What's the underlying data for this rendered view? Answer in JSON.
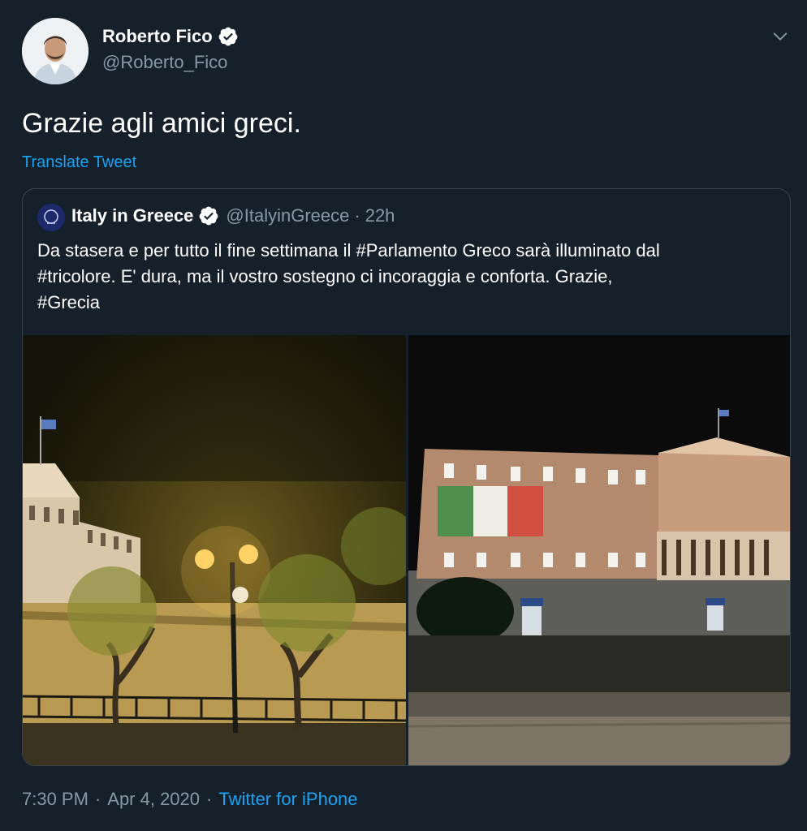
{
  "author": {
    "display_name": "Roberto Fico",
    "handle": "@Roberto_Fico"
  },
  "tweet": {
    "text": "Grazie agli amici greci.",
    "translate_label": "Translate Tweet",
    "time": "7:30 PM",
    "date": "Apr 4, 2020",
    "source": "Twitter for iPhone",
    "separator": "·"
  },
  "quoted": {
    "display_name": "Italy in Greece",
    "handle": "@ItalyinGreece",
    "separator": "·",
    "age": "22h",
    "text_lines": [
      "Da stasera e per tutto il fine settimana il #Parlamento Greco sarà illuminato dal",
      "#tricolore. E' dura, ma il vostro sostegno ci incoraggia e conforta. Grazie,",
      "#Grecia"
    ]
  },
  "icons": {
    "verified": "verified-badge-icon",
    "caret": "chevron-down-icon"
  },
  "colors": {
    "background": "#15202b",
    "secondary_text": "#8899a6",
    "link": "#1da1f2",
    "border": "#38444d"
  }
}
